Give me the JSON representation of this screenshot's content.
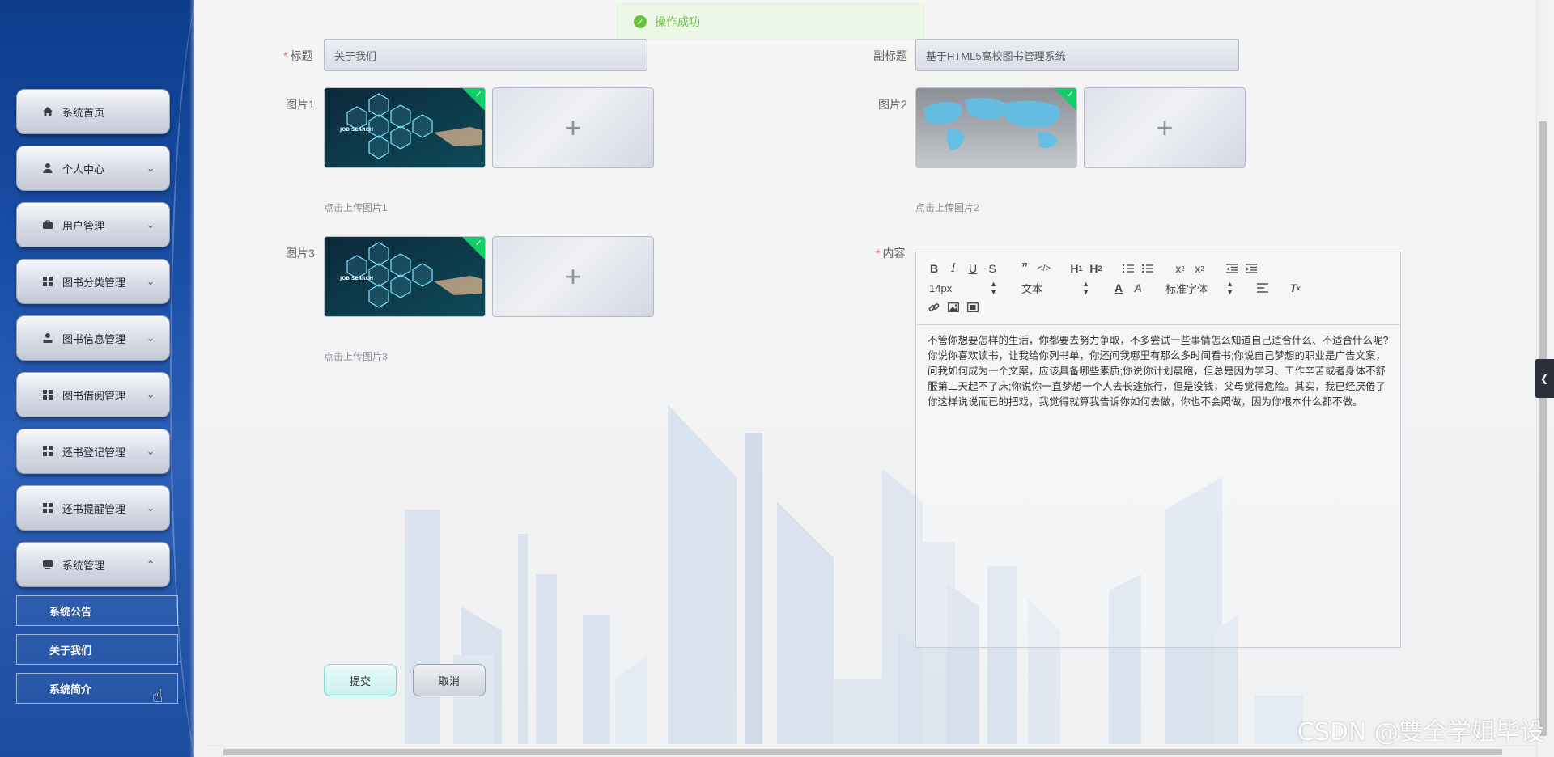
{
  "sidebar": {
    "items": [
      {
        "label": "系统首页",
        "icon": "home-icon",
        "has_chevron": false
      },
      {
        "label": "个人中心",
        "icon": "user-icon",
        "has_chevron": true
      },
      {
        "label": "用户管理",
        "icon": "briefcase-icon",
        "has_chevron": true
      },
      {
        "label": "图书分类管理",
        "icon": "grid-icon",
        "has_chevron": true
      },
      {
        "label": "图书信息管理",
        "icon": "person-icon",
        "has_chevron": true
      },
      {
        "label": "图书借阅管理",
        "icon": "grid-icon",
        "has_chevron": true
      },
      {
        "label": "还书登记管理",
        "icon": "grid-icon",
        "has_chevron": true
      },
      {
        "label": "还书提醒管理",
        "icon": "grid-icon",
        "has_chevron": true
      },
      {
        "label": "系统管理",
        "icon": "monitor-icon",
        "has_chevron": true,
        "expanded": true
      }
    ],
    "submenu": [
      "系统公告",
      "关于我们",
      "系统简介"
    ]
  },
  "toast": {
    "text": "操作成功",
    "color": "#67c23a"
  },
  "form": {
    "title_label": "标题",
    "title_value": "关于我们",
    "subtitle_label": "副标题",
    "subtitle_value": "基于HTML5高校图书管理系统",
    "pic1_label": "图片1",
    "pic1_hint": "点击上传图片1",
    "pic2_label": "图片2",
    "pic2_hint": "点击上传图片2",
    "pic3_label": "图片3",
    "pic3_hint": "点击上传图片3",
    "content_label": "内容",
    "plus": "+",
    "job_search_text": "JOB SEARCH"
  },
  "editor": {
    "font_size": "14px",
    "heading": "文本",
    "font_family": "标准字体",
    "content": "不管你想要怎样的生活，你都要去努力争取，不多尝试一些事情怎么知道自己适合什么、不适合什么呢? 你说你喜欢读书，让我给你列书单，你还问我哪里有那么多时间看书;你说自己梦想的职业是广告文案，问我如何成为一个文案，应该具备哪些素质;你说你计划晨跑，但总是因为学习、工作辛苦或者身体不舒服第二天起不了床;你说你一直梦想一个人去长途旅行，但是没钱，父母觉得危险。其实，我已经厌倦了你这样说说而已的把戏，我觉得就算我告诉你如何去做，你也不会照做，因为你根本什么都不做。"
  },
  "buttons": {
    "submit": "提交",
    "cancel": "取消"
  },
  "watermark": "CSDN @雙全学姐毕设"
}
